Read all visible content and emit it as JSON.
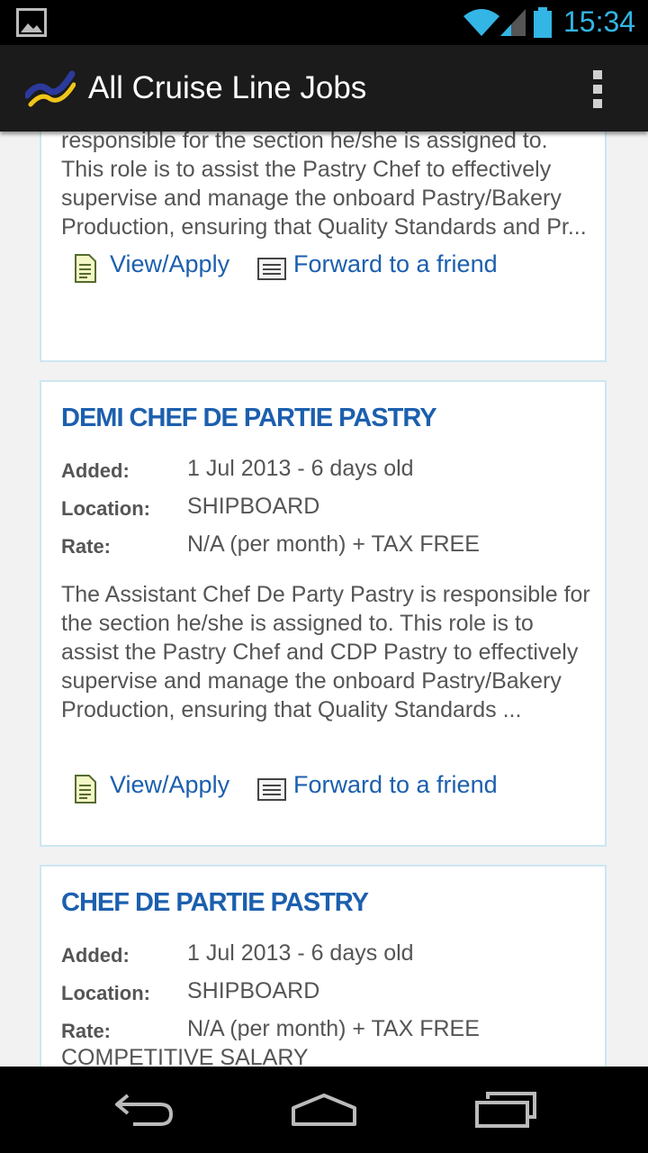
{
  "status_bar": {
    "time": "15:34"
  },
  "app_bar": {
    "title": "All Cruise Line Jobs"
  },
  "listings": [
    {
      "description": "responsible for the section he/she is assigned to. This role is to assist the Pastry Chef to effectively supervise and manage the onboard Pastry/Bakery Production, ensuring that Quality Standards and Pr...",
      "view_label": "View/Apply",
      "forward_label": "Forward to a friend"
    },
    {
      "title": "DEMI CHEF DE PARTIE PASTRY",
      "added_label": "Added:",
      "added_value": "1 Jul 2013 - 6 days old",
      "location_label": "Location:",
      "location_value": "SHIPBOARD",
      "rate_label": "Rate:",
      "rate_value": "N/A (per month) + TAX FREE",
      "description": "The Assistant Chef De Party Pastry is responsible for the section he/she is assigned to. This role is to assist the Pastry Chef and CDP Pastry to effectively supervise and manage the onboard Pastry/Bakery Production, ensuring that Quality Standards ...",
      "view_label": "View/Apply",
      "forward_label": "Forward to a friend"
    },
    {
      "title": "CHEF DE PARTIE PASTRY",
      "added_label": "Added:",
      "added_value": "1 Jul 2013 - 6 days old",
      "location_label": "Location:",
      "location_value": "SHIPBOARD",
      "rate_label": "Rate:",
      "rate_value": "N/A (per month) + TAX FREE",
      "rate_extra": "COMPETITIVE SALARY"
    }
  ],
  "colors": {
    "accent": "#1c5fae",
    "card_border": "#cde6f2",
    "clock": "#33b5e5"
  },
  "icons": {
    "view": "document-icon",
    "forward": "email-icon",
    "back": "back-icon",
    "home": "home-icon",
    "recents": "recent-apps-icon"
  }
}
